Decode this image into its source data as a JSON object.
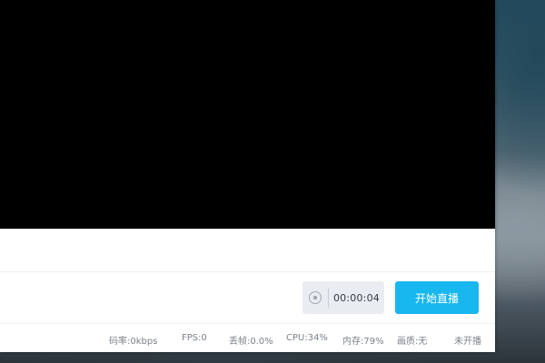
{
  "controls": {
    "timer": "00:00:04",
    "start_button_label": "开始直播"
  },
  "status": {
    "bitrate": "码率:0kbps",
    "fps": "FPS:0",
    "dropped_frames": "丢帧:0.0%",
    "cpu": "CPU:34%",
    "memory": "内存:79%",
    "quality": "画质:无",
    "live_state": "未开播"
  },
  "colors": {
    "accent": "#19b7f0",
    "preview_bg": "#000000",
    "timer_bg": "#e9edf2"
  },
  "icons": {
    "stop": "stop-circle-icon"
  }
}
